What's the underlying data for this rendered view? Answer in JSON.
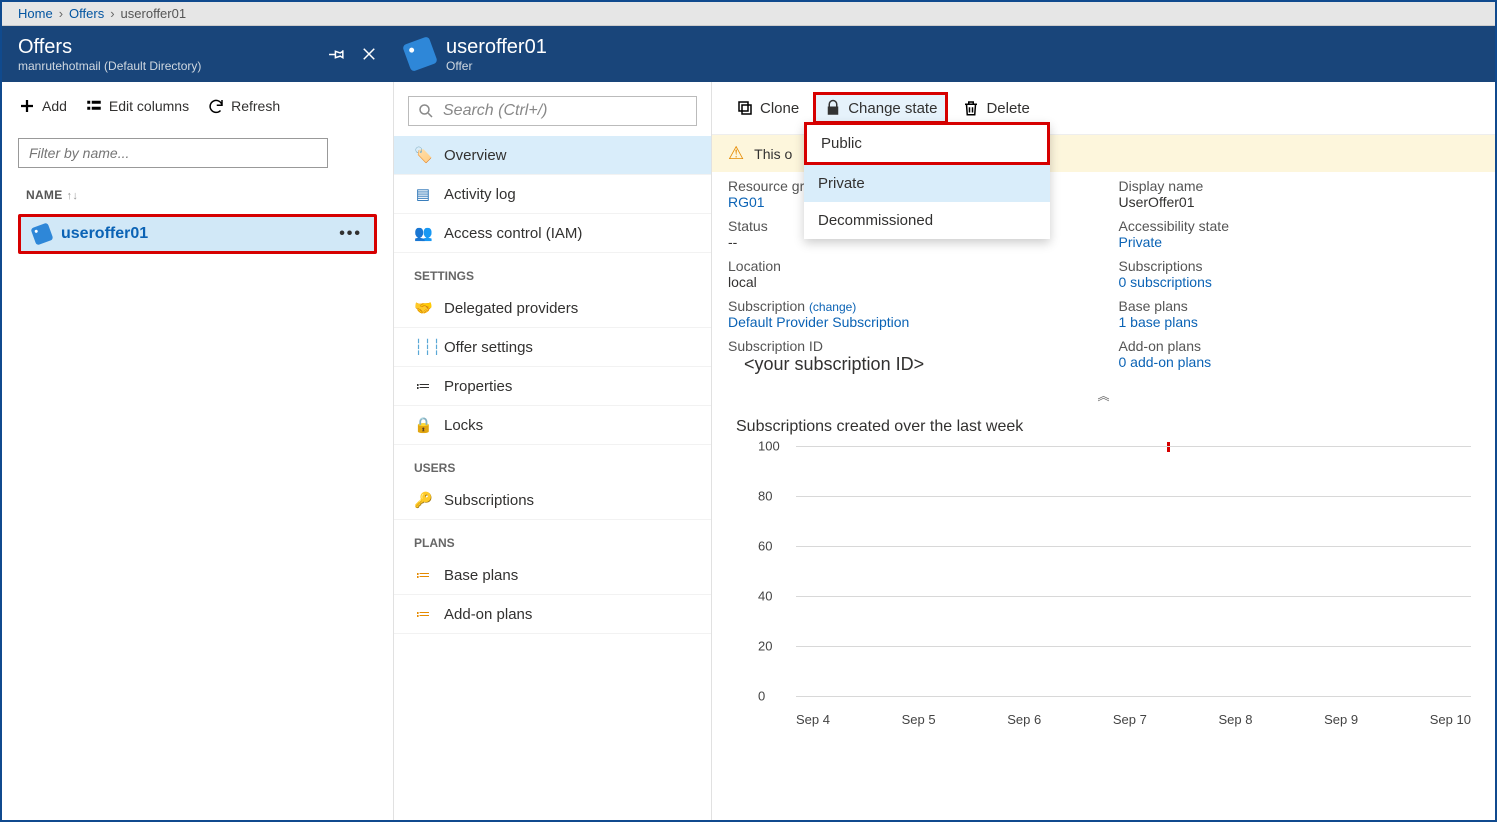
{
  "breadcrumb": {
    "home": "Home",
    "offers": "Offers",
    "current": "useroffer01"
  },
  "offersBlade": {
    "title": "Offers",
    "subtitle": "manrutehotmail (Default Directory)",
    "toolbar": {
      "add": "Add",
      "editColumns": "Edit columns",
      "refresh": "Refresh"
    },
    "filterPlaceholder": "Filter by name...",
    "nameHeader": "NAME",
    "items": [
      {
        "name": "useroffer01"
      }
    ]
  },
  "detailHeader": {
    "title": "useroffer01",
    "subtitle": "Offer"
  },
  "nav": {
    "searchPlaceholder": "Search (Ctrl+/)",
    "main": [
      {
        "icon": "tag",
        "label": "Overview",
        "active": true
      },
      {
        "icon": "log",
        "label": "Activity log"
      },
      {
        "icon": "iam",
        "label": "Access control (IAM)"
      }
    ],
    "settingsLabel": "SETTINGS",
    "settings": [
      {
        "icon": "delegated",
        "label": "Delegated providers"
      },
      {
        "icon": "sliders",
        "label": "Offer settings"
      },
      {
        "icon": "props",
        "label": "Properties"
      },
      {
        "icon": "lock",
        "label": "Locks"
      }
    ],
    "usersLabel": "USERS",
    "users": [
      {
        "icon": "key",
        "label": "Subscriptions"
      }
    ],
    "plansLabel": "PLANS",
    "plans": [
      {
        "icon": "list",
        "label": "Base plans"
      },
      {
        "icon": "list",
        "label": "Add-on plans"
      }
    ]
  },
  "detailToolbar": {
    "clone": "Clone",
    "changeState": "Change state",
    "delete": "Delete"
  },
  "banner": {
    "text": "This o"
  },
  "stateMenu": {
    "public": "Public",
    "private": "Private",
    "decommissioned": "Decommissioned"
  },
  "props": {
    "left": {
      "resourceGroupLabel": "Resource gr",
      "resourceGroupValue": "RG01",
      "statusLabel": "Status",
      "statusValue": "--",
      "locationLabel": "Location",
      "locationValue": "local",
      "subscriptionLabel": "Subscription",
      "subscriptionChange": "(change)",
      "subscriptionValue": "Default Provider Subscription",
      "subIdLabel": "Subscription ID",
      "subIdValue": "<your subscription ID>"
    },
    "right": {
      "displayNameLabel": "Display name",
      "displayNameValue": "UserOffer01",
      "accessLabel": "Accessibility state",
      "accessValue": "Private",
      "subsLabel": "Subscriptions",
      "subsValue": "0 subscriptions",
      "basePlansLabel": "Base plans",
      "basePlansValue": "1 base plans",
      "addonLabel": "Add-on plans",
      "addonValue": "0 add-on plans"
    }
  },
  "chart_data": {
    "type": "line",
    "title": "Subscriptions created over the last week",
    "categories": [
      "Sep 4",
      "Sep 5",
      "Sep 6",
      "Sep 7",
      "Sep 8",
      "Sep 9",
      "Sep 10"
    ],
    "values": [
      null,
      null,
      null,
      null,
      null,
      null,
      null
    ],
    "y_ticks": [
      0,
      20,
      40,
      60,
      80,
      100
    ],
    "ylim": [
      0,
      100
    ]
  }
}
